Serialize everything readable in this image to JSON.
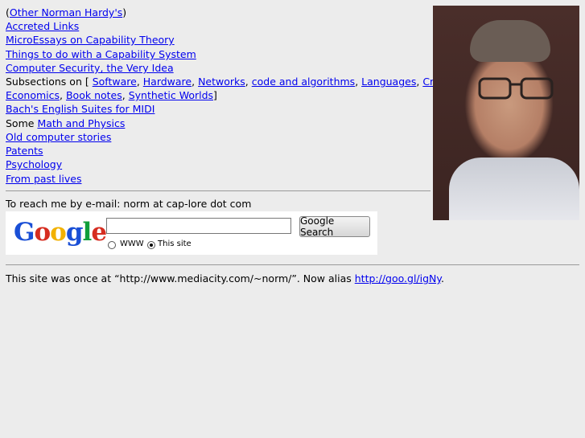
{
  "intro": {
    "open": "(",
    "link": "Other Norman Hardy's",
    "close": ")"
  },
  "links": [
    "Accreted Links",
    "MicroEssays on Capability Theory",
    "Things to do with a Capability System",
    "Computer Security, the Very Idea"
  ],
  "subsections": {
    "prefix": "Subsections on [ ",
    "items": [
      "Software",
      "Hardware",
      "Networks",
      "code and algorithms",
      "Languages",
      "Crypto",
      "Economics",
      "Book notes",
      "Synthetic Worlds"
    ],
    "suffix": "]"
  },
  "bach": "Bach's English Suites for MIDI",
  "some": {
    "prefix": "Some ",
    "link": "Math and Physics"
  },
  "more_links": [
    "Old computer stories",
    "Patents",
    "Psychology",
    "From past lives"
  ],
  "email": "To reach me by e-mail: norm at cap-lore dot com",
  "google": {
    "logo_letters": [
      "G",
      "o",
      "o",
      "g",
      "l",
      "e"
    ],
    "logo_colors": [
      "#1a4fd6",
      "#d62d20",
      "#f2b100",
      "#1a4fd6",
      "#109e3a",
      "#d62d20"
    ],
    "tm": "™",
    "search_value": "",
    "button": "Google Search",
    "radio_www": "WWW",
    "radio_site": "This site",
    "selected": "This site"
  },
  "footer": {
    "text": "This site was once at “http://www.mediacity.com/~norm/”. Now alias ",
    "link": "http://goo.gl/igNy",
    "end": "."
  },
  "photo": "portrait-photo"
}
